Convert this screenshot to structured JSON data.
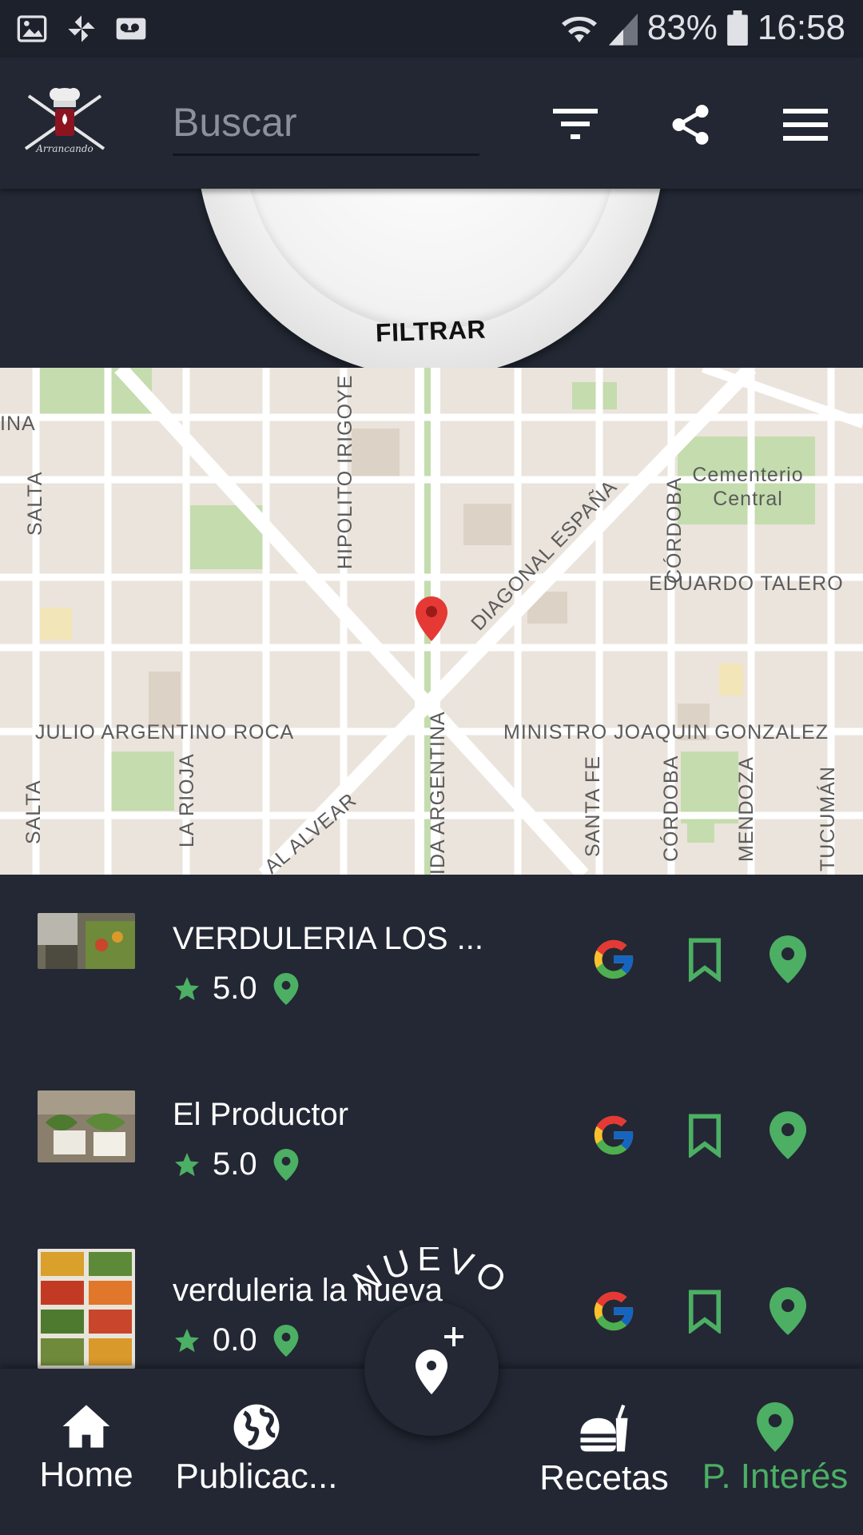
{
  "status_bar": {
    "battery": "83%",
    "time": "16:58",
    "icons": [
      "image-icon",
      "pinwheel-icon",
      "voicemail-icon",
      "wifi-icon",
      "signal-icon",
      "battery-icon"
    ]
  },
  "app_bar": {
    "logo_text": "Arrancando",
    "search_placeholder": "Buscar",
    "actions": [
      "filter-icon",
      "share-icon",
      "menu-icon"
    ]
  },
  "filter": {
    "label": "FILTRAR"
  },
  "map": {
    "labels": {
      "salta_top": "SALTA",
      "salta_bottom": "SALTA",
      "ina": "INA",
      "hipolito": "HIPOLITO IRIGOYE",
      "diagonal": "DIAGONAL ESPAÑA",
      "cordoba_top": "CÓRDOBA",
      "cementerio_1": "Cementerio",
      "cementerio_2": "Central",
      "eduardo": "EDUARDO TALERO",
      "julio": "JULIO ARGENTINO ROCA",
      "ministro": "MINISTRO JOAQUIN GONZALEZ",
      "la_rioja": "LA RIOJA",
      "alvear": "AL ALVEAR",
      "argentina": "IDA ARGENTINA",
      "santa_fe": "SANTA FE",
      "cordoba_bottom": "CÓRDOBA",
      "mendoza": "MENDOZA",
      "tucuman": "TUCUMÁN"
    }
  },
  "places": [
    {
      "name": "VERDULERIA LOS ...",
      "rating": "5.0"
    },
    {
      "name": "El Productor",
      "rating": "5.0"
    },
    {
      "name": "verduleria la nueva",
      "rating": "0.0"
    }
  ],
  "fab": {
    "label": "NUEVO"
  },
  "bottom_nav": [
    {
      "label": "Home",
      "icon": "home-icon"
    },
    {
      "label": "Publicac...",
      "icon": "globe-icon"
    },
    {
      "label": "Recetas",
      "icon": "food-icon"
    },
    {
      "label": "P. Interés",
      "icon": "location-pin-icon",
      "active": true
    }
  ],
  "colors": {
    "background": "#232834",
    "accent_green": "#4caf64",
    "map_pin": "#e53935"
  }
}
